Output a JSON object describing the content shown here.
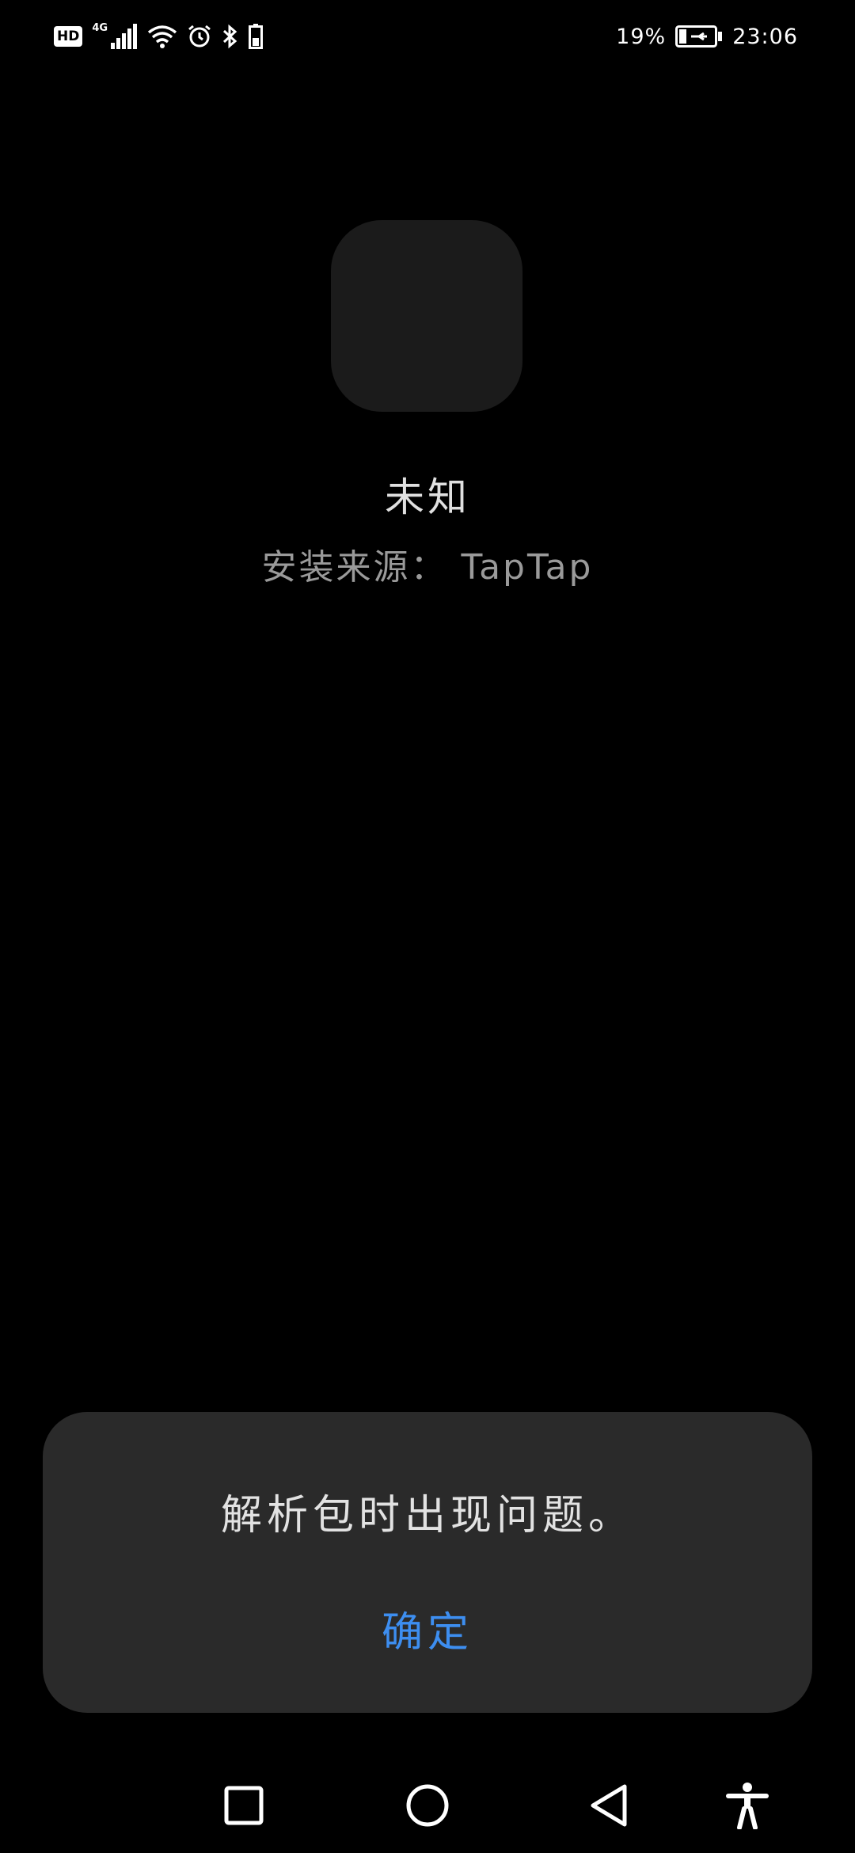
{
  "status_bar": {
    "hd_label": "HD",
    "network_type": "4G",
    "battery_percent": "19%",
    "time": "23:06",
    "icons": [
      "signal-icon",
      "wifi-icon",
      "alarm-icon",
      "bluetooth-icon",
      "battery-small-icon",
      "battery-charging-icon"
    ]
  },
  "app": {
    "name": "未知",
    "install_source": "安装来源： TapTap"
  },
  "dialog": {
    "message": "解析包时出现问题。",
    "confirm_label": "确定",
    "confirm_color": "#3d8ef0"
  },
  "nav_bar": {
    "icons": [
      "recents-square-icon",
      "home-circle-icon",
      "back-triangle-icon",
      "accessibility-icon"
    ]
  }
}
